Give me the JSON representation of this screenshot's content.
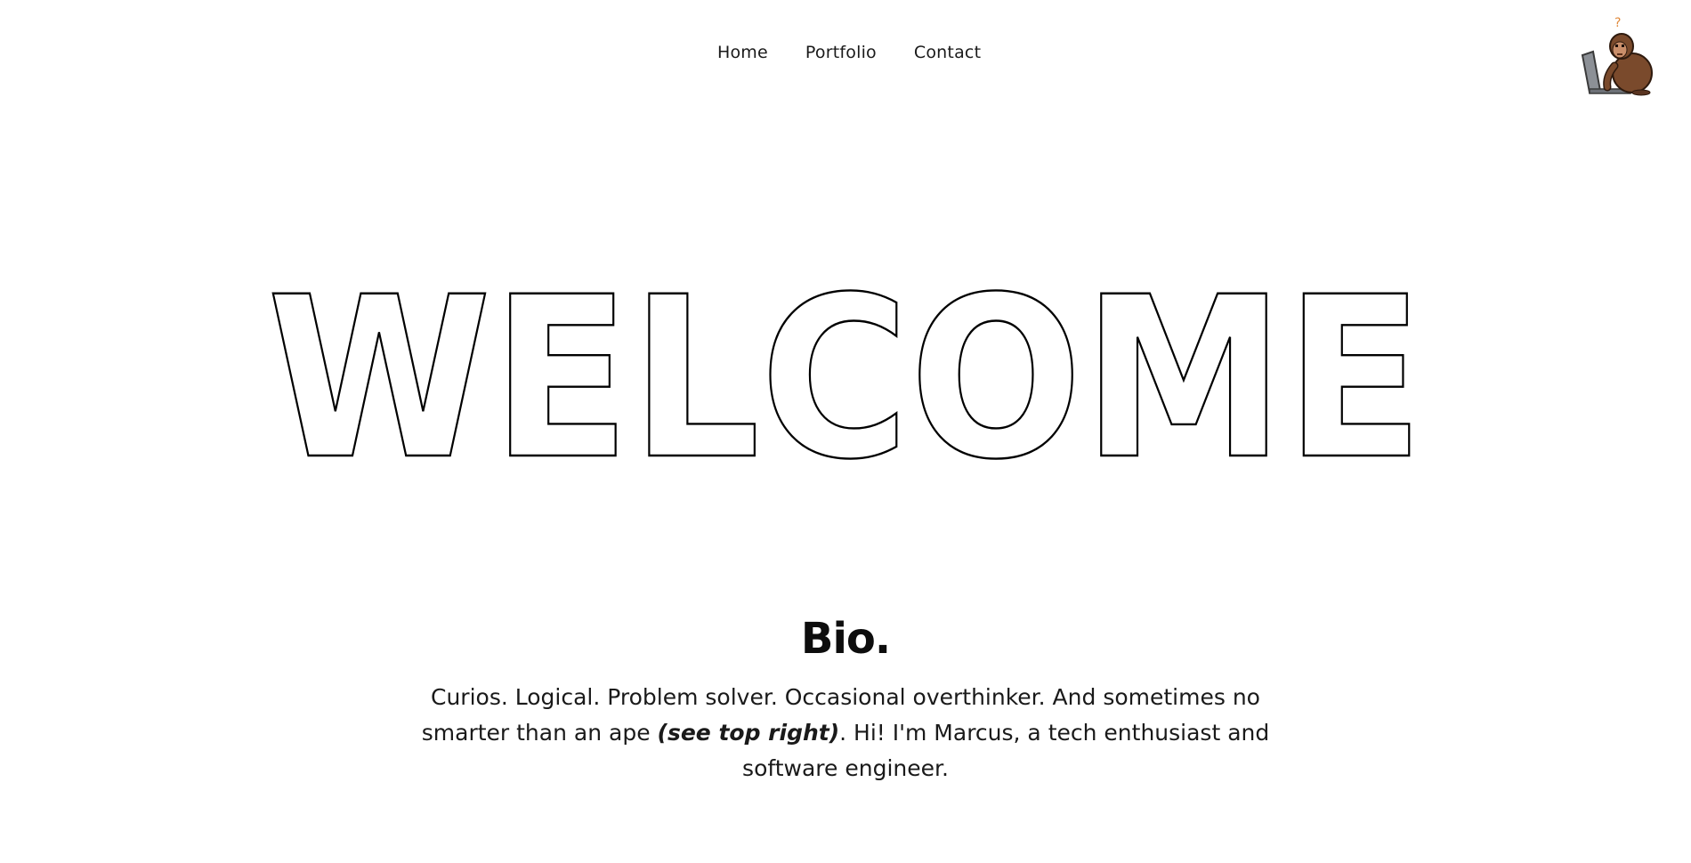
{
  "nav": {
    "items": [
      {
        "label": "Home"
      },
      {
        "label": "Portfolio"
      },
      {
        "label": "Contact"
      }
    ]
  },
  "mascot": {
    "icon": "ape-at-laptop-icon",
    "question_mark": "?"
  },
  "hero": {
    "title": "WELCOME"
  },
  "bio": {
    "heading": "Bio.",
    "text_before": "Curios. Logical. Problem solver. Occasional overthinker. And sometimes no smarter than an ape ",
    "emphasis": "(see top right)",
    "text_after": ". Hi! I'm Marcus, a tech enthusiast and software engineer."
  },
  "colors": {
    "background": "#ffffff",
    "text": "#1a1a1a",
    "ape_fur": "#7a4a2c",
    "question_mark": "#e08a3c",
    "laptop": "#8c9096"
  }
}
